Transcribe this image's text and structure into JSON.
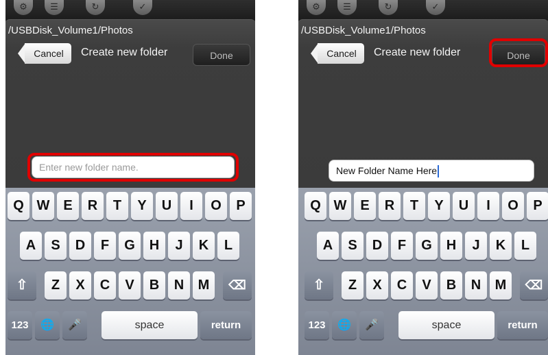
{
  "path": "/USBDisk_Volume1/Photos",
  "dialog": {
    "cancel_label": "Cancel",
    "title": "Create new folder",
    "done_label": "Done"
  },
  "input": {
    "placeholder": "Enter new folder name.",
    "filled_value": "New Folder Name Here"
  },
  "keyboard": {
    "row1": [
      "Q",
      "W",
      "E",
      "R",
      "T",
      "Y",
      "U",
      "I",
      "O",
      "P"
    ],
    "row2": [
      "A",
      "S",
      "D",
      "F",
      "G",
      "H",
      "J",
      "K",
      "L"
    ],
    "row3": [
      "Z",
      "X",
      "C",
      "V",
      "B",
      "N",
      "M"
    ],
    "numbers_label": "123",
    "space_label": "space",
    "return_label": "return",
    "shift_symbol": "⇧",
    "delete_symbol": "⌫",
    "globe_symbol": "🌐",
    "mic_symbol": "🎤"
  },
  "colors": {
    "highlight": "#e00000",
    "caret": "#2a6ad6"
  }
}
